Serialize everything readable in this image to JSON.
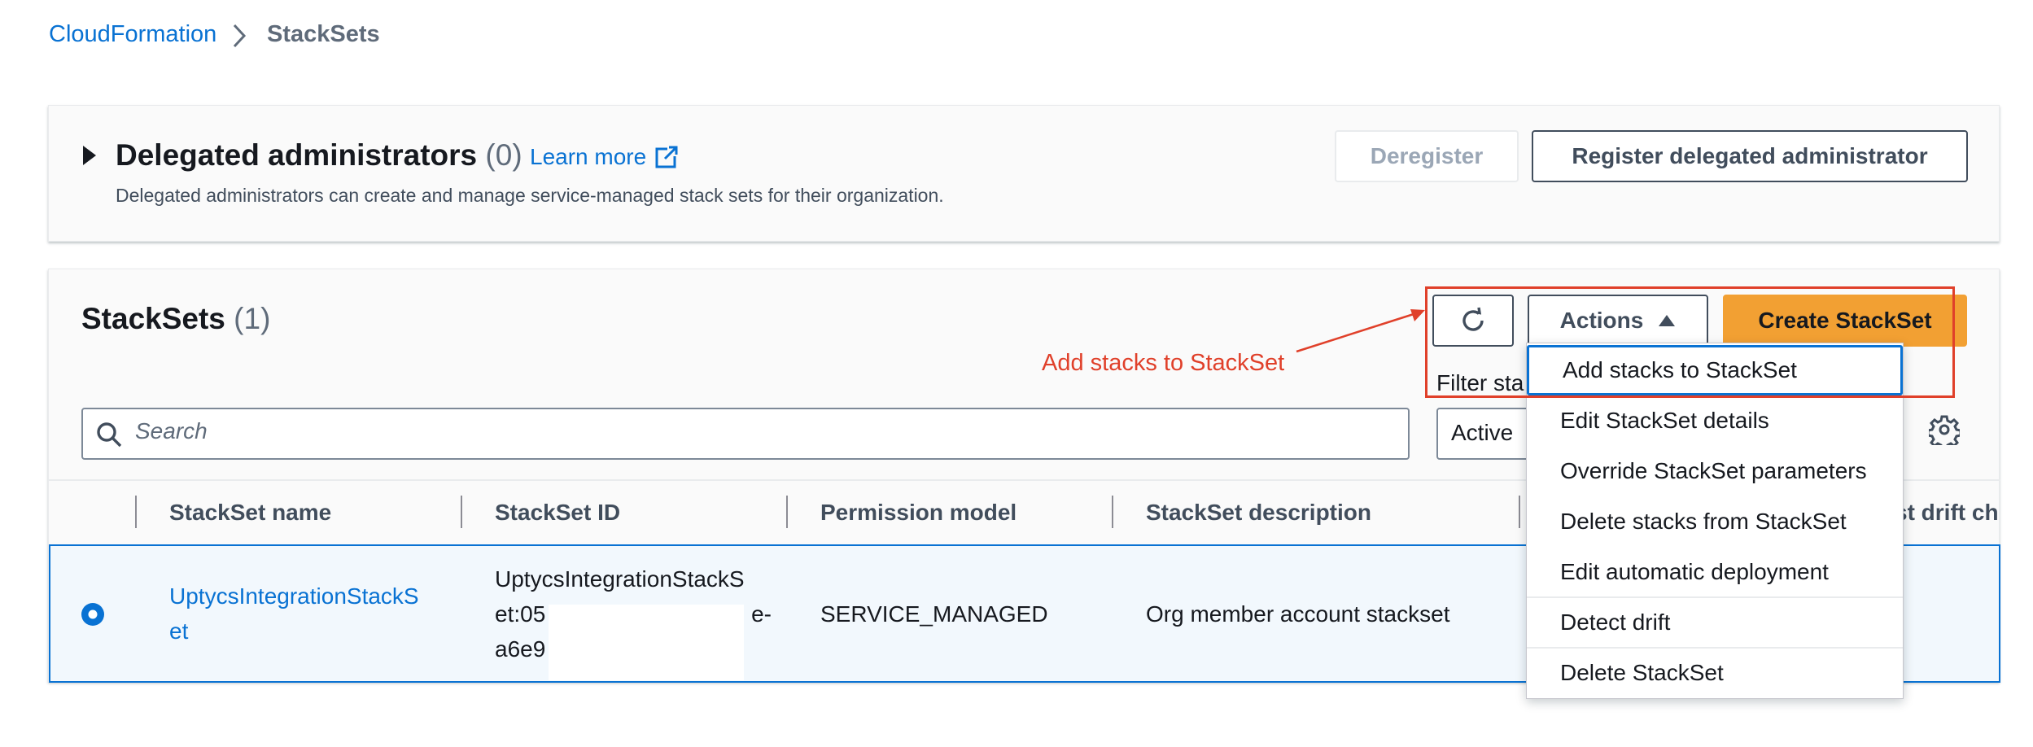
{
  "breadcrumb": {
    "root": "CloudFormation",
    "current": "StackSets"
  },
  "delegated": {
    "title": "Delegated administrators",
    "count": "(0)",
    "learn_more": "Learn more",
    "description": "Delegated administrators can create and manage service-managed stack sets for their organization.",
    "deregister_label": "Deregister",
    "register_label": "Register delegated administrator"
  },
  "stacksets": {
    "title": "StackSets",
    "count": "(1)",
    "actions_label": "Actions",
    "create_label": "Create StackSet",
    "filter_label": "Filter sta",
    "search_placeholder": "Search",
    "status_value": "Active",
    "columns": [
      "StackSet name",
      "StackSet ID",
      "Permission model",
      "StackSet description",
      "st drift ch"
    ],
    "row": {
      "name_line1": "UptycsIntegrationStackS",
      "name_line2": "et",
      "id_line1": "UptycsIntegrationStackS",
      "id_line2": "et:05",
      "id_line2_tail": "e-",
      "id_line3": "a6e9",
      "permission": "SERVICE_MANAGED",
      "description": "Org member account stackset"
    }
  },
  "actions_menu": [
    "Add stacks to StackSet",
    "Edit StackSet details",
    "Override StackSet parameters",
    "Delete stacks from StackSet",
    "Edit automatic deployment",
    "Detect drift",
    "Delete StackSet"
  ],
  "annotation": {
    "text": "Add stacks to StackSet",
    "color": "#e0402a"
  },
  "colors": {
    "link": "#0972d3",
    "primary": "#f2a033",
    "selected_row": "#f2f8fd"
  }
}
